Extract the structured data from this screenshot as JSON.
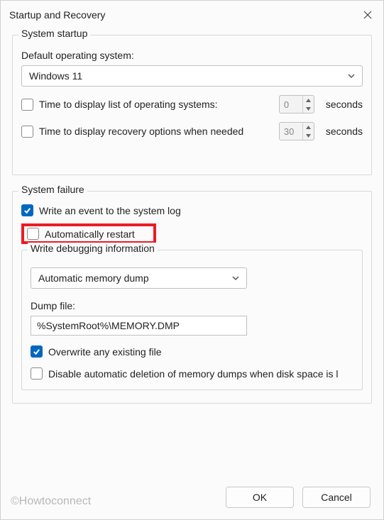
{
  "window": {
    "title": "Startup and Recovery"
  },
  "startup": {
    "legend": "System startup",
    "default_os_label": "Default operating system:",
    "default_os_value": "Windows 11",
    "time_list_label": "Time to display list of operating systems:",
    "time_list_value": "0",
    "time_recovery_label": "Time to display recovery options when needed",
    "time_recovery_value": "30",
    "seconds_label": "seconds"
  },
  "failure": {
    "legend": "System failure",
    "write_event_label": "Write an event to the system log",
    "auto_restart_label": "Automatically restart",
    "debug_legend": "Write debugging information",
    "dump_type_value": "Automatic memory dump",
    "dump_file_label": "Dump file:",
    "dump_file_value": "%SystemRoot%\\MEMORY.DMP",
    "overwrite_label": "Overwrite any existing file",
    "disable_delete_label": "Disable automatic deletion of memory dumps when disk space is l"
  },
  "buttons": {
    "ok": "OK",
    "cancel": "Cancel"
  },
  "watermark": "©Howtoconnect"
}
